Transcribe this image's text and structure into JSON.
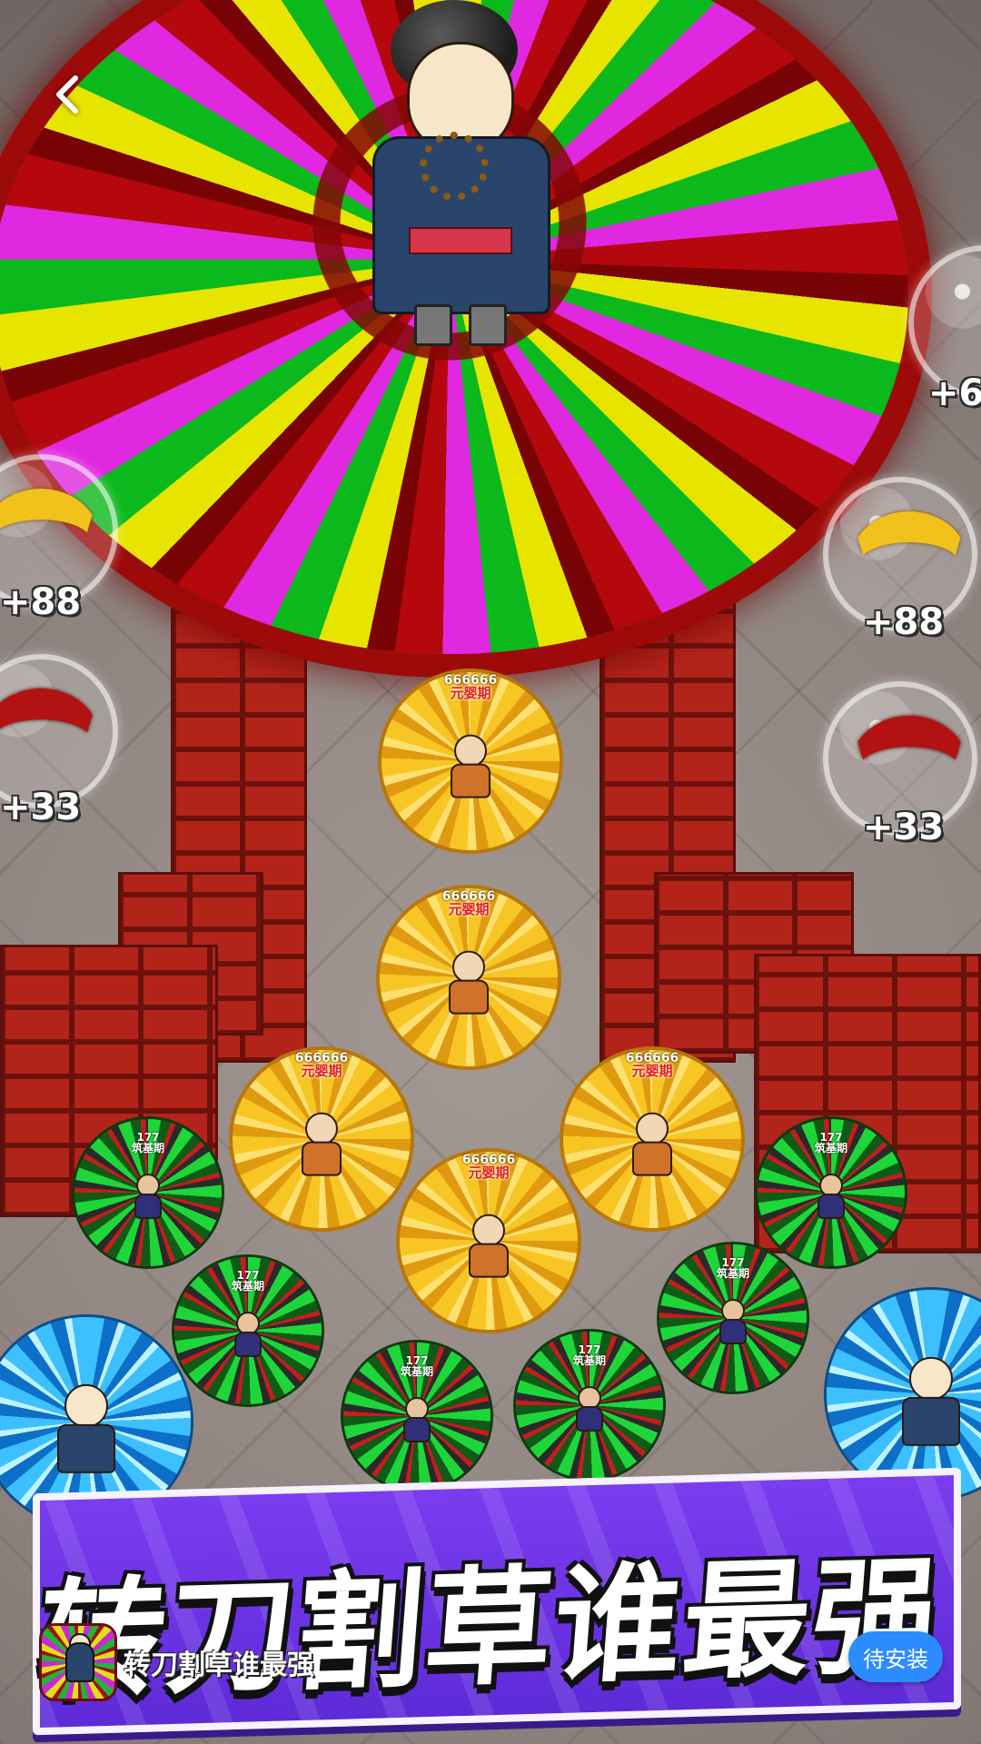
{
  "nav": {
    "back_icon": "chevron-left-icon"
  },
  "hud": {
    "left_bonuses": [
      "+88",
      "+33"
    ],
    "right_bonuses": [
      "+6",
      "+88",
      "+33"
    ]
  },
  "enemies": {
    "elder_power": "666666",
    "elder_realm": "元婴期",
    "disciple_power": "177",
    "disciple_realm": "筑基期"
  },
  "banner": {
    "headline": "转刀割草谁最强"
  },
  "app": {
    "name": "转刀割草谁最强",
    "install_label": "待安装",
    "colors": {
      "install_button": "#2b8cff",
      "banner_bg": "#6a32e0"
    }
  }
}
